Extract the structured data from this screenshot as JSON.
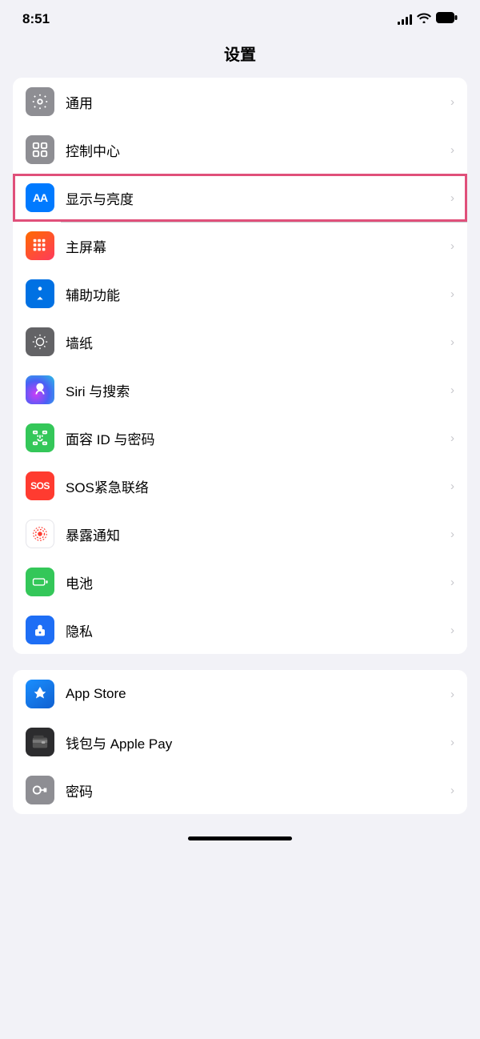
{
  "statusBar": {
    "time": "8:51"
  },
  "pageTitle": "设置",
  "section1": {
    "rows": [
      {
        "id": "general",
        "label": "通用",
        "iconType": "gray",
        "iconSymbol": "gear"
      },
      {
        "id": "control-center",
        "label": "控制中心",
        "iconType": "gray",
        "iconSymbol": "toggle"
      },
      {
        "id": "display",
        "label": "显示与亮度",
        "iconType": "blue",
        "iconSymbol": "AA",
        "highlighted": true
      },
      {
        "id": "home-screen",
        "label": "主屏幕",
        "iconType": "homescreen",
        "iconSymbol": "grid"
      },
      {
        "id": "accessibility",
        "label": "辅助功能",
        "iconType": "teal",
        "iconSymbol": "accessibility"
      },
      {
        "id": "wallpaper",
        "label": "墙纸",
        "iconType": "purple",
        "iconSymbol": "flower"
      },
      {
        "id": "siri",
        "label": "Siri 与搜索",
        "iconType": "siri",
        "iconSymbol": "siri"
      },
      {
        "id": "face-id",
        "label": "面容 ID 与密码",
        "iconType": "green",
        "iconSymbol": "faceid"
      },
      {
        "id": "sos",
        "label": "SOS紧急联络",
        "iconType": "red",
        "iconSymbol": "SOS"
      },
      {
        "id": "exposure",
        "label": "暴露通知",
        "iconType": "exposure",
        "iconSymbol": "exposure"
      },
      {
        "id": "battery",
        "label": "电池",
        "iconType": "green2",
        "iconSymbol": "battery"
      },
      {
        "id": "privacy",
        "label": "隐私",
        "iconType": "blue2",
        "iconSymbol": "hand"
      }
    ]
  },
  "section2": {
    "rows": [
      {
        "id": "app-store",
        "label": "App Store",
        "iconType": "app-store",
        "iconSymbol": "appstore"
      },
      {
        "id": "wallet",
        "label": "钱包与 Apple Pay",
        "iconType": "charcoal",
        "iconSymbol": "wallet"
      },
      {
        "id": "passwords",
        "label": "密码",
        "iconType": "gray2",
        "iconSymbol": "key"
      }
    ]
  },
  "chevron": "›"
}
